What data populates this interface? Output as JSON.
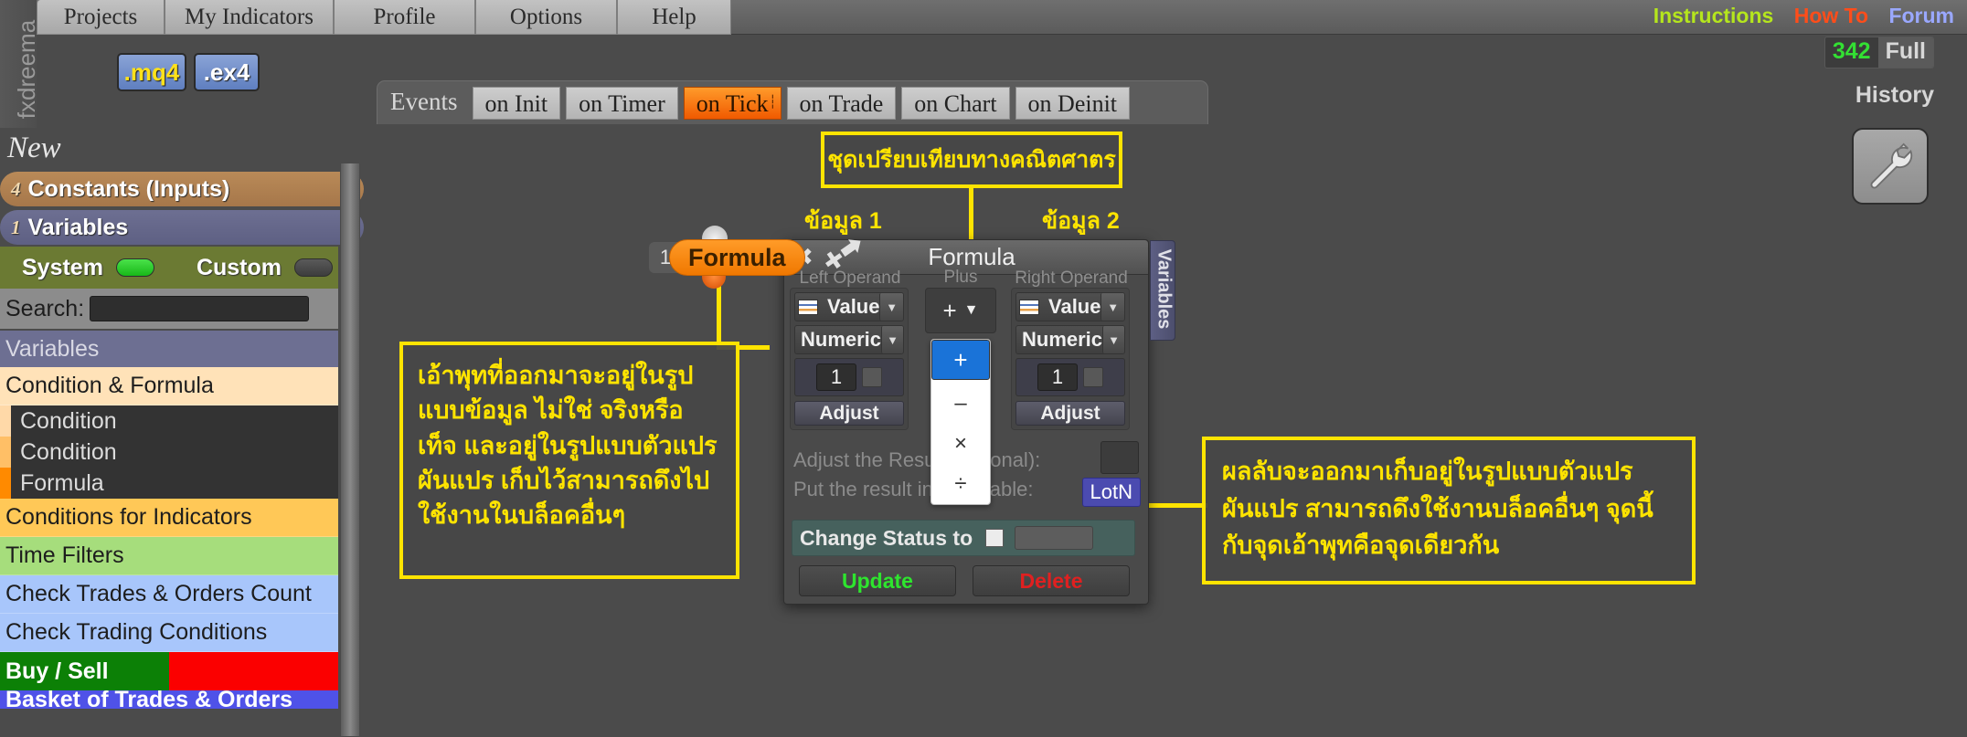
{
  "brand": {
    "name": "fxdreema"
  },
  "menu": {
    "items": [
      {
        "label": "Projects"
      },
      {
        "label": "My Indicators"
      },
      {
        "label": "Profile"
      },
      {
        "label": "Options"
      },
      {
        "label": "Help"
      }
    ]
  },
  "toplinks": {
    "instructions": "Instructions",
    "howto": "How To",
    "forum": "Forum",
    "version_count": "342",
    "version_mode": "Full",
    "history": "History"
  },
  "filebuttons": {
    "mq4": ".mq4",
    "ex4": ".ex4"
  },
  "events": {
    "label": "Events",
    "tabs": [
      {
        "label": "on Init",
        "active": false
      },
      {
        "label": "on Timer",
        "active": false
      },
      {
        "label": "on Tick",
        "active": true
      },
      {
        "label": "on Trade",
        "active": false
      },
      {
        "label": "on Chart",
        "active": false
      },
      {
        "label": "on Deinit",
        "active": false
      }
    ]
  },
  "sidebar": {
    "new_label": "New",
    "constants": {
      "count": "4",
      "label": "Constants (Inputs)"
    },
    "variables": {
      "count": "1",
      "label": "Variables"
    },
    "system_label": "System",
    "custom_label": "Custom",
    "search_label": "Search:",
    "search_value": "",
    "search_placeholder": "",
    "section_header": "Variables",
    "items": [
      {
        "label": "Condition & Formula"
      },
      {
        "label": "Conditions for Indicators"
      },
      {
        "label": "Time Filters"
      },
      {
        "label": "Check Trades & Orders Count"
      },
      {
        "label": "Check Trading Conditions"
      }
    ],
    "sub_items": [
      {
        "label": "Condition"
      },
      {
        "label": "Condition"
      },
      {
        "label": "Formula"
      }
    ],
    "buysell_label": "Buy / Sell",
    "basket_label": "Basket of Trades & Orders"
  },
  "node": {
    "number": "1",
    "label": "Formula"
  },
  "dialog": {
    "title": "Formula",
    "close_icon": "close-icon",
    "pin_icon": "pin-icon",
    "left_operand": {
      "caption": "Left Operand",
      "type": "Value",
      "subtype": "Numeric",
      "value": "1",
      "adjust_label": "Adjust"
    },
    "right_operand": {
      "caption": "Right Operand",
      "type": "Value",
      "subtype": "Numeric",
      "value": "1",
      "adjust_label": "Adjust"
    },
    "operator": {
      "caption": "Plus",
      "selected": "+",
      "options": [
        {
          "label": "+",
          "selected": true
        },
        {
          "label": "–",
          "selected": false
        },
        {
          "label": "×",
          "selected": false
        },
        {
          "label": "÷",
          "selected": false
        }
      ]
    },
    "adjust_line": "Adjust the Result (optional):",
    "put_line": "Put the result into Variable:",
    "result_variable": "LotN",
    "status_label": "Change Status to",
    "status_value": "",
    "update_label": "Update",
    "delete_label": "Delete",
    "variables_tab": "Variables"
  },
  "annotations": {
    "top_box": "ชุดเปรียบเทียบทางคณิตศาตร",
    "data1": "ข้อมูล 1",
    "data2": "ข้อมูล 2",
    "left_box": "เอ้าพุทที่ออกมาจะอยู่ในรูปแบบข้อมูล ไม่ใช่ จริงหรือเท็จ และอยู่ในรูปแบบตัวแปรผันแปร เก็บไว้สามารถดึงไปใช้งานในบล็อคอื่นๆ",
    "right_box": "ผลลับจะออกมาเก็บอยู่ในรูปแบบตัวแปรผันแปร สามารถดึงใช้งานบล็อคอื่นๆ จุดนี้กับจุดเอ้าพุทคือจุดเดียวกัน"
  },
  "toolbar": {
    "wrench_icon": "wrench-icon"
  },
  "colors": {
    "accent_orange": "#f07800",
    "annotation_yellow": "#ffe400",
    "link_green": "#b5e61d",
    "link_orange": "#ff4d1a",
    "link_blue": "#9aa8ff",
    "buy_green": "#0c8006",
    "sell_red": "#fb0000"
  }
}
